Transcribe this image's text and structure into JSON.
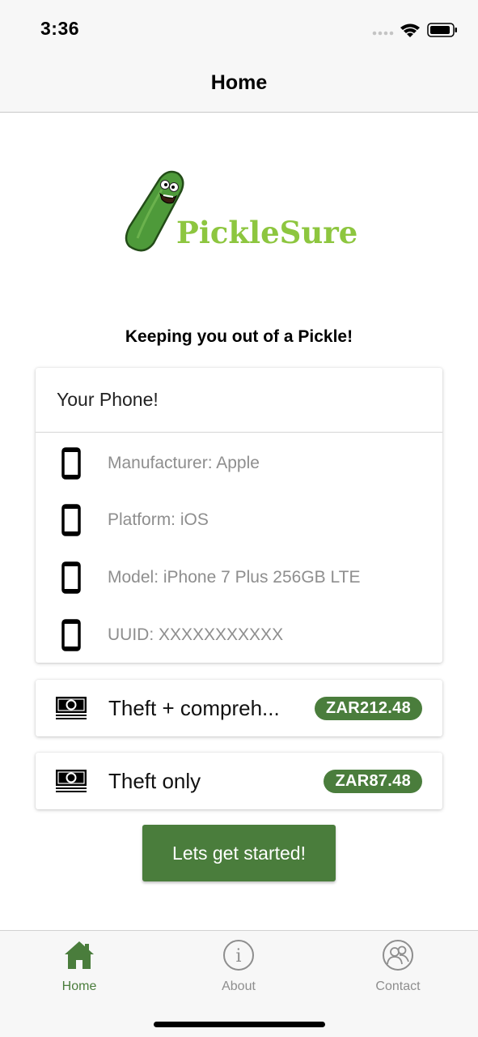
{
  "status_bar": {
    "time": "3:36"
  },
  "header": {
    "title": "Home"
  },
  "logo": {
    "text": "PickleSure"
  },
  "tagline": "Keeping you out of a Pickle!",
  "phone_card": {
    "title": "Your Phone!",
    "items": [
      {
        "label": "Manufacturer: Apple",
        "icon": "phone-icon"
      },
      {
        "label": "Platform: iOS",
        "icon": "phone-icon"
      },
      {
        "label": "Model: iPhone 7 Plus 256GB LTE",
        "icon": "phone-icon"
      },
      {
        "label": "UUID: XXXXXXXXXXX",
        "icon": "phone-icon"
      }
    ]
  },
  "plans": [
    {
      "name": "Theft + compreh...",
      "price": "ZAR212.48",
      "icon": "money-icon"
    },
    {
      "name": "Theft only",
      "price": "ZAR87.48",
      "icon": "money-icon"
    }
  ],
  "cta": {
    "label": "Lets get started!"
  },
  "tabs": [
    {
      "label": "Home",
      "icon": "home-icon",
      "active": true
    },
    {
      "label": "About",
      "icon": "info-icon",
      "active": false
    },
    {
      "label": "Contact",
      "icon": "contacts-icon",
      "active": false
    }
  ],
  "colors": {
    "accent": "#4a7d3c",
    "logo_green": "#8dc63f",
    "muted_text": "#8e8e8e"
  }
}
